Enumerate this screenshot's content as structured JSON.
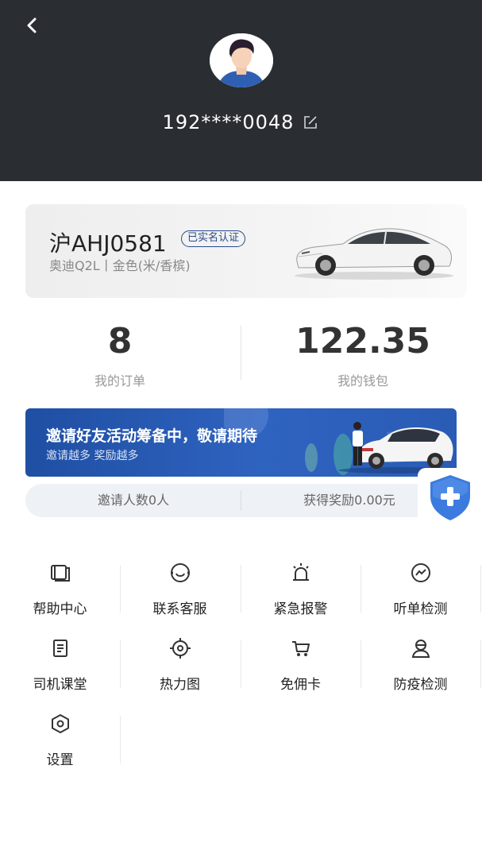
{
  "header": {
    "phone": "192****0048"
  },
  "car": {
    "plate": "沪AHJ0581",
    "verify_badge": "已实名认证",
    "description": "奥迪Q2L丨金色(米/香槟)"
  },
  "stats": {
    "orders_value": "8",
    "orders_label": "我的订单",
    "wallet_value": "122.35",
    "wallet_label": "我的钱包"
  },
  "banner": {
    "title": "邀请好友活动筹备中，敬请期待",
    "subtitle": "邀请越多 奖励越多"
  },
  "invite": {
    "count_text": "邀请人数0人",
    "reward_text": "获得奖励0.00元"
  },
  "menu": [
    {
      "label": "帮助中心",
      "icon": "help-book-icon"
    },
    {
      "label": "联系客服",
      "icon": "customer-service-icon"
    },
    {
      "label": "紧急报警",
      "icon": "alarm-siren-icon"
    },
    {
      "label": "听单检测",
      "icon": "order-detect-icon"
    },
    {
      "label": "司机课堂",
      "icon": "driver-class-icon"
    },
    {
      "label": "热力图",
      "icon": "heatmap-target-icon"
    },
    {
      "label": "免佣卡",
      "icon": "cart-icon"
    },
    {
      "label": "防疫检测",
      "icon": "epidemic-check-icon"
    },
    {
      "label": "设置",
      "icon": "settings-hexagon-icon"
    }
  ],
  "colors": {
    "header_bg": "#2a2d32",
    "banner_blue": "#2f63c0",
    "badge_blue": "#2a4a8a",
    "shield_blue": "#3b7be0"
  }
}
